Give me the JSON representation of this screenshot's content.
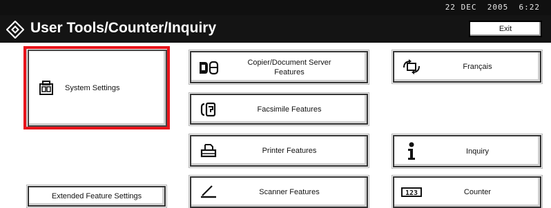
{
  "status": {
    "datetime": "22 DEC  2005  6:22"
  },
  "title": {
    "text": "User Tools/Counter/Inquiry",
    "icon": "diamond-tools-icon"
  },
  "exit_label": "Exit",
  "colors": {
    "highlight": "#e8141b",
    "titlebar": "#141414"
  },
  "buttons": {
    "system_settings": {
      "label": "System Settings",
      "icon": "system-settings-icon"
    },
    "copier": {
      "label_line1": "Copier/Document Server",
      "label_line2": "Features",
      "icon": "copier-document-server-icon"
    },
    "facsimile": {
      "label": "Facsimile Features",
      "icon": "facsimile-icon"
    },
    "printer": {
      "label": "Printer Features",
      "icon": "printer-icon"
    },
    "scanner": {
      "label": "Scanner Features",
      "icon": "scanner-icon"
    },
    "language": {
      "label": "Français",
      "icon": "language-switch-icon"
    },
    "inquiry": {
      "label": "Inquiry",
      "icon": "info-icon"
    },
    "counter": {
      "label": "Counter",
      "icon": "counter-icon"
    },
    "extended": {
      "label": "Extended Feature Settings"
    }
  }
}
